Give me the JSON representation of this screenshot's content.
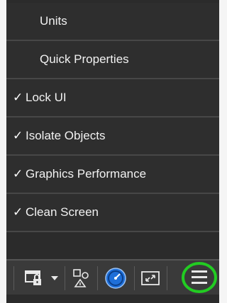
{
  "menu": {
    "items": [
      {
        "label": "Units",
        "checked": false
      },
      {
        "label": "Quick Properties",
        "checked": false
      },
      {
        "label": "Lock UI",
        "checked": true
      },
      {
        "label": "Isolate Objects",
        "checked": true
      },
      {
        "label": "Graphics Performance",
        "checked": true
      },
      {
        "label": "Clean Screen",
        "checked": true
      }
    ],
    "check_glyph": "✓"
  },
  "toolbar": {
    "icons": [
      "lock-workspace-icon",
      "dropdown-arrow-icon",
      "isolate-objects-icon",
      "hardware-acceleration-icon",
      "clean-screen-icon",
      "customization-menu-icon"
    ],
    "highlight_color": "#22cc22",
    "accent_color": "#1e6fd9"
  }
}
